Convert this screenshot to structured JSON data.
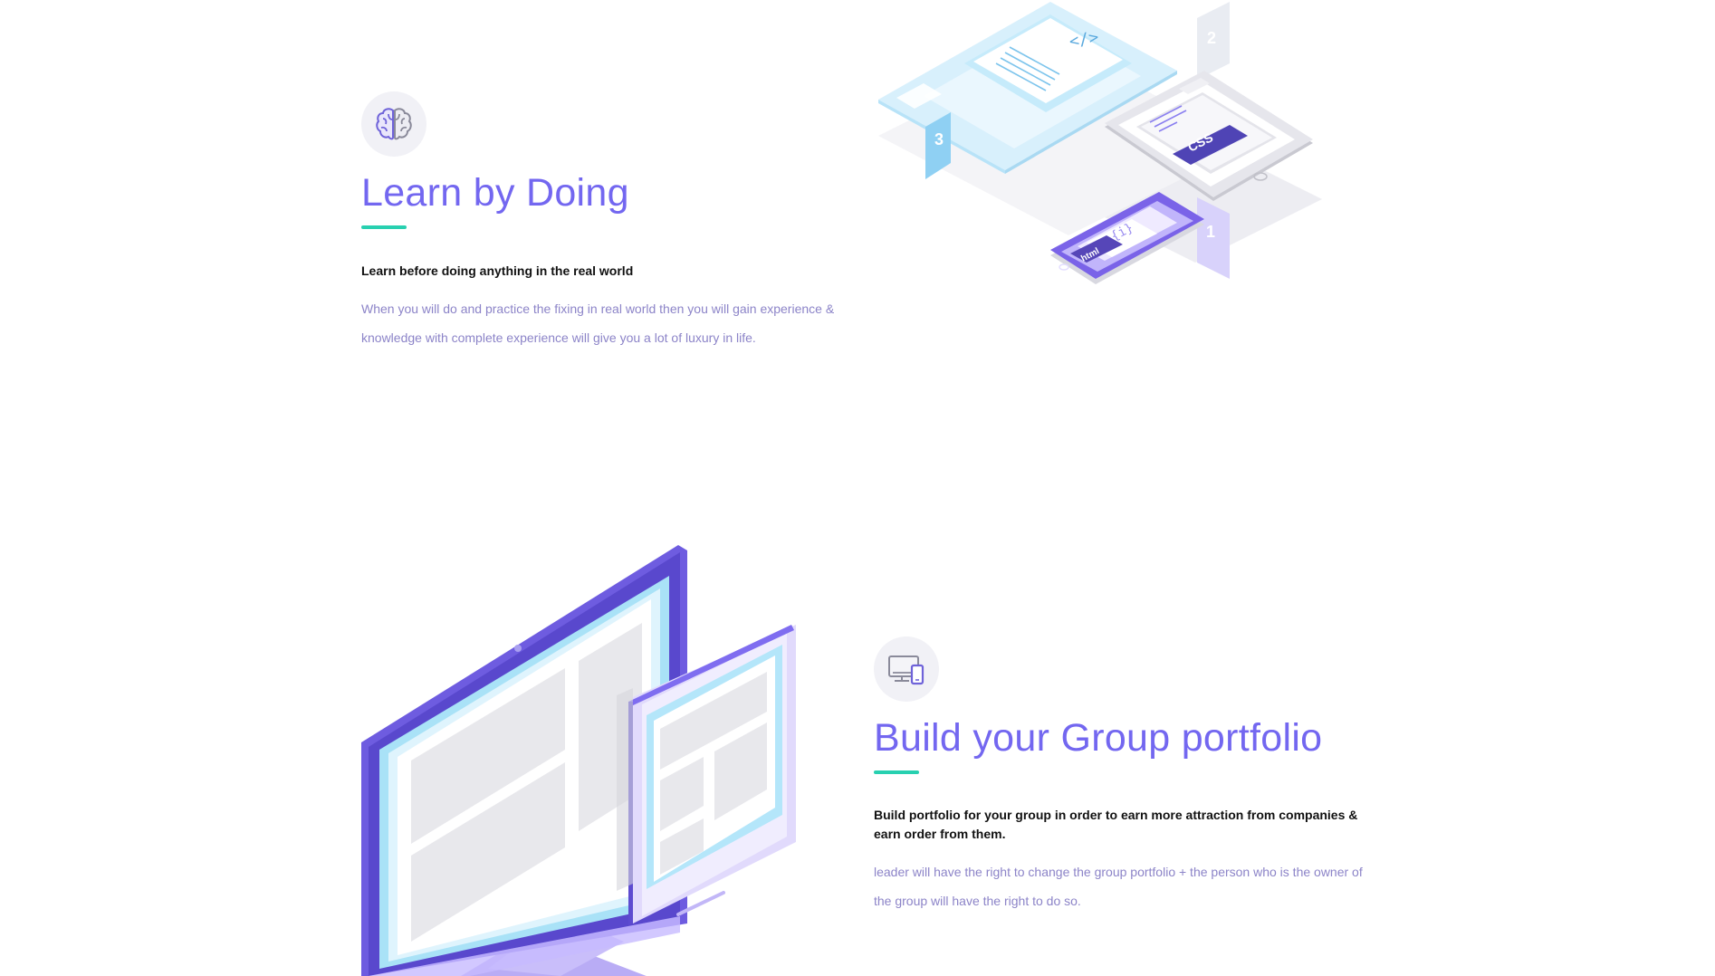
{
  "features": [
    {
      "icon": "brain-icon",
      "title": "Learn by Doing",
      "subtitle": "Learn before doing anything in the real world",
      "description": "When you will do and practice the fixing in real world then you will gain experience & knowledge with complete experience will give you a lot of luxury in life.",
      "illustration": {
        "code_tag": "</>",
        "css_label": "CSS",
        "html_label": "html",
        "step_labels": [
          "1",
          "2",
          "3"
        ]
      }
    },
    {
      "icon": "devices-icon",
      "title": "Build your Group portfolio",
      "subtitle": "Build portfolio for your group in order to earn more attraction from companies & earn order from them.",
      "description": "leader will have the right to change the group portfolio + the person who is the owner of the group will have the right to do so."
    }
  ],
  "colors": {
    "accent": "#7367f0",
    "underline": "#28d0b0",
    "body_text": "#8c84c8",
    "heading_text": "#111111",
    "icon_bg": "#f1f1f6"
  }
}
